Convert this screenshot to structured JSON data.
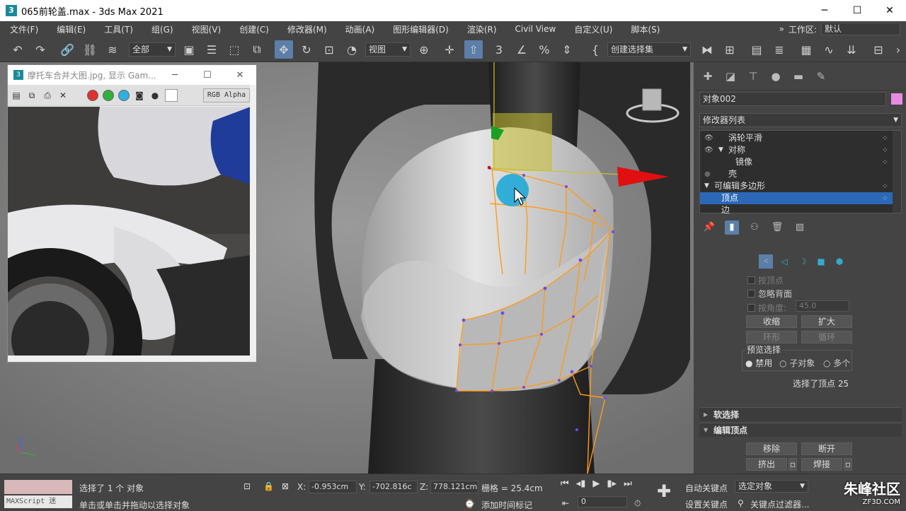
{
  "window": {
    "title": "065前轮盖.max - 3ds Max 2021",
    "icon": "3"
  },
  "menu": [
    "文件(F)",
    "编辑(E)",
    "工具(T)",
    "组(G)",
    "视图(V)",
    "创建(C)",
    "修改器(M)",
    "动画(A)",
    "图形编辑器(D)",
    "渲染(R)",
    "Civil View",
    "自定义(U)",
    "脚本(S)"
  ],
  "workspace": {
    "label": "工作区:",
    "value": "默认"
  },
  "toolbar": {
    "filter": "全部",
    "refcoord": "视图",
    "selset": "创建选择集"
  },
  "image_window": {
    "title": "摩托车合并大图.jpg, 显示 Gam...",
    "channel_label": "RGB Alpha",
    "colors": {
      "red": "#e03030",
      "green": "#30b040",
      "blue": "#30b0e0"
    }
  },
  "command_panel": {
    "object_name": "对象002",
    "object_color": "#e88ae0",
    "modifier_list": "修改器列表",
    "stack": [
      {
        "label": "涡轮平滑",
        "level": 0
      },
      {
        "label": "对称",
        "level": 0
      },
      {
        "label": "镜像",
        "level": 1
      },
      {
        "label": "壳",
        "level": 0
      },
      {
        "label": "可编辑多边形",
        "level": 0
      },
      {
        "label": "顶点",
        "level": 1,
        "selected": true
      },
      {
        "label": "边",
        "level": 1
      }
    ],
    "selection": {
      "by_vertex": "按顶点",
      "ignore_backface": "忽略背面",
      "by_angle": "按角度:",
      "angle_value": "45.0",
      "shrink": "收缩",
      "grow": "扩大",
      "ring": "环形",
      "loop": "循环",
      "preview_label": "预览选择",
      "preview_off": "禁用",
      "preview_sub": "子对象",
      "preview_multi": "多个",
      "status": "选择了顶点 25"
    },
    "soft_selection": "软选择",
    "edit_vertices": "编辑顶点",
    "remove": "移除",
    "break": "断开",
    "extrude": "挤出",
    "weld": "焊接"
  },
  "status": {
    "selected": "选择了 1 个 对象",
    "hint": "单击或单击并拖动以选择对象",
    "maxscript": "MAXScript 迷",
    "x_label": "X:",
    "x": "-0.953cm",
    "y_label": "Y:",
    "y": "-702.816c",
    "z_label": "Z:",
    "z": "778.121cm",
    "grid": "栅格 = 25.4cm",
    "add_time_tag": "添加时间标记",
    "frame": "0",
    "auto_key": "自动关键点",
    "set_key": "设置关键点",
    "selected_obj": "选定对象",
    "key_filters": "关键点过滤器..."
  },
  "watermark": {
    "name": "朱峰社区",
    "url": "ZF3D.COM"
  }
}
